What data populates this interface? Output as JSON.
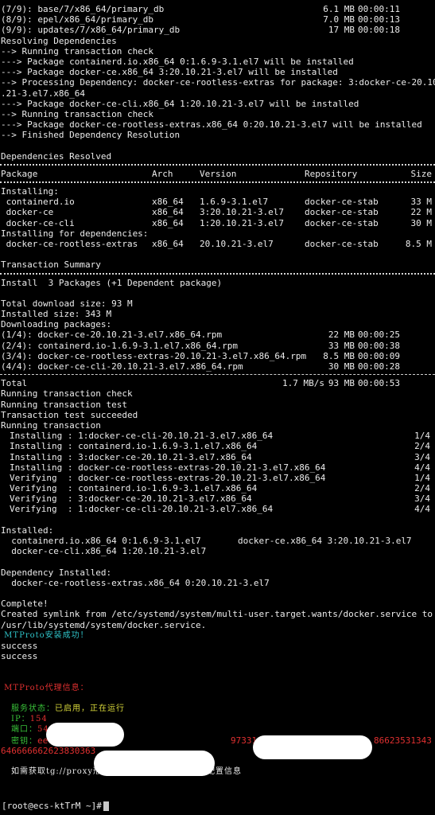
{
  "progress_lines": [
    {
      "name": "(7/9): base/7/x86_64/primary_db",
      "size": "6.1 MB",
      "time": "00:00:11"
    },
    {
      "name": "(8/9): epel/x86_64/primary_db",
      "size": "7.0 MB",
      "time": "00:00:13"
    },
    {
      "name": "(9/9): updates/7/x86_64/primary_db",
      "size": "17 MB",
      "time": "00:00:18"
    }
  ],
  "resolving": [
    "Resolving Dependencies",
    "--> Running transaction check",
    "---> Package containerd.io.x86_64 0:1.6.9-3.1.el7 will be installed",
    "---> Package docker-ce.x86_64 3:20.10.21-3.el7 will be installed",
    "--> Processing Dependency: docker-ce-rootless-extras for package: 3:docker-ce-20.10",
    ".21-3.el7.x86_64",
    "---> Package docker-ce-cli.x86_64 1:20.10.21-3.el7 will be installed",
    "--> Running transaction check",
    "---> Package docker-ce-rootless-extras.x86_64 0:20.10.21-3.el7 will be installed",
    "--> Finished Dependency Resolution",
    "",
    "Dependencies Resolved"
  ],
  "table_header": {
    "package": "Package",
    "arch": "Arch",
    "version": "Version",
    "repository": "Repository",
    "size": "Size"
  },
  "installing_label": "Installing:",
  "packages": [
    {
      "name": " containerd.io",
      "arch": "x86_64",
      "version": "1.6.9-3.1.el7",
      "repo": "docker-ce-stable",
      "size": "33 M"
    },
    {
      "name": " docker-ce",
      "arch": "x86_64",
      "version": "3:20.10.21-3.el7",
      "repo": "docker-ce-stable",
      "size": "22 M"
    },
    {
      "name": " docker-ce-cli",
      "arch": "x86_64",
      "version": "1:20.10.21-3.el7",
      "repo": "docker-ce-stable",
      "size": "30 M"
    }
  ],
  "deps_label": "Installing for dependencies:",
  "dep_packages": [
    {
      "name": " docker-ce-rootless-extras",
      "arch": "x86_64",
      "version": "20.10.21-3.el7",
      "repo": "docker-ce-stable",
      "size": "8.5 M"
    }
  ],
  "summary_title": "Transaction Summary",
  "install_summary": "Install  3 Packages (+1 Dependent package)",
  "sizes": [
    "Total download size: 93 M",
    "Installed size: 343 M",
    "Downloading packages:"
  ],
  "downloads": [
    {
      "name": "(1/4): docker-ce-20.10.21-3.el7.x86_64.rpm",
      "size": "22 MB",
      "time": "00:00:25"
    },
    {
      "name": "(2/4): containerd.io-1.6.9-3.1.el7.x86_64.rpm",
      "size": "33 MB",
      "time": "00:00:38"
    },
    {
      "name": "(3/4): docker-ce-rootless-extras-20.10.21-3.el7.x86_64.rpm",
      "size": "8.5 MB",
      "time": "00:00:09"
    },
    {
      "name": "(4/4): docker-ce-cli-20.10.21-3.el7.x86_64.rpm",
      "size": "30 MB",
      "time": "00:00:28"
    }
  ],
  "total": {
    "label": "Total",
    "rate": "1.7 MB/s",
    "size": "93 MB",
    "time": "00:00:53"
  },
  "transaction": [
    "Running transaction check",
    "Running transaction test",
    "Transaction test succeeded",
    "Running transaction"
  ],
  "steps": [
    {
      "text": "Installing : 1:docker-ce-cli-20.10.21-3.el7.x86_64",
      "count": "1/4"
    },
    {
      "text": "Installing : containerd.io-1.6.9-3.1.el7.x86_64",
      "count": "2/4"
    },
    {
      "text": "Installing : 3:docker-ce-20.10.21-3.el7.x86_64",
      "count": "3/4"
    },
    {
      "text": "Installing : docker-ce-rootless-extras-20.10.21-3.el7.x86_64",
      "count": "4/4"
    },
    {
      "text": "Verifying  : docker-ce-rootless-extras-20.10.21-3.el7.x86_64",
      "count": "1/4"
    },
    {
      "text": "Verifying  : containerd.io-1.6.9-3.1.el7.x86_64",
      "count": "2/4"
    },
    {
      "text": "Verifying  : 3:docker-ce-20.10.21-3.el7.x86_64",
      "count": "3/4"
    },
    {
      "text": "Verifying  : 1:docker-ce-cli-20.10.21-3.el7.x86_64",
      "count": "4/4"
    }
  ],
  "installed_label": "Installed:",
  "installed_lines": [
    "  containerd.io.x86_64 0:1.6.9-3.1.el7       docker-ce.x86_64 3:20.10.21-3.el7",
    "  docker-ce-cli.x86_64 1:20.10.21-3.el7"
  ],
  "dep_installed_label": "Dependency Installed:",
  "dep_installed_lines": [
    "  docker-ce-rootless-extras.x86_64 0:20.10.21-3.el7"
  ],
  "complete": [
    "Complete!",
    "Created symlink from /etc/systemd/system/multi-user.target.wants/docker.service to",
    "/usr/lib/systemd/system/docker.service."
  ],
  "mtproto_installing": " MTProto安装成功！",
  "success_lines": [
    "success",
    "success"
  ],
  "mtproto_info_title": " MTProto代理信息：",
  "info": {
    "status_label": "服务状态：",
    "status_value": "已启用，正在运行",
    "ip_label": "IP：",
    "ip_value": "154",
    "port_label": "端口：",
    "port_value": "54",
    "secret_label": "密钥：",
    "secret_value": "eec0e5ee9...",
    "secret_tail": "9733163393...",
    "secret_tail2": "86623531343",
    "secret_line2": "646666662623830363"
  },
  "hint": "如需获取tg://proxy形式的链接，请到菜单中获取配置信息",
  "prompt": "[root@ecs-ktTrM ~]#",
  "colors": {
    "cyan": "#2fc3c8",
    "red": "#e03030",
    "green": "#39c239",
    "yellow": "#d6d63a"
  }
}
